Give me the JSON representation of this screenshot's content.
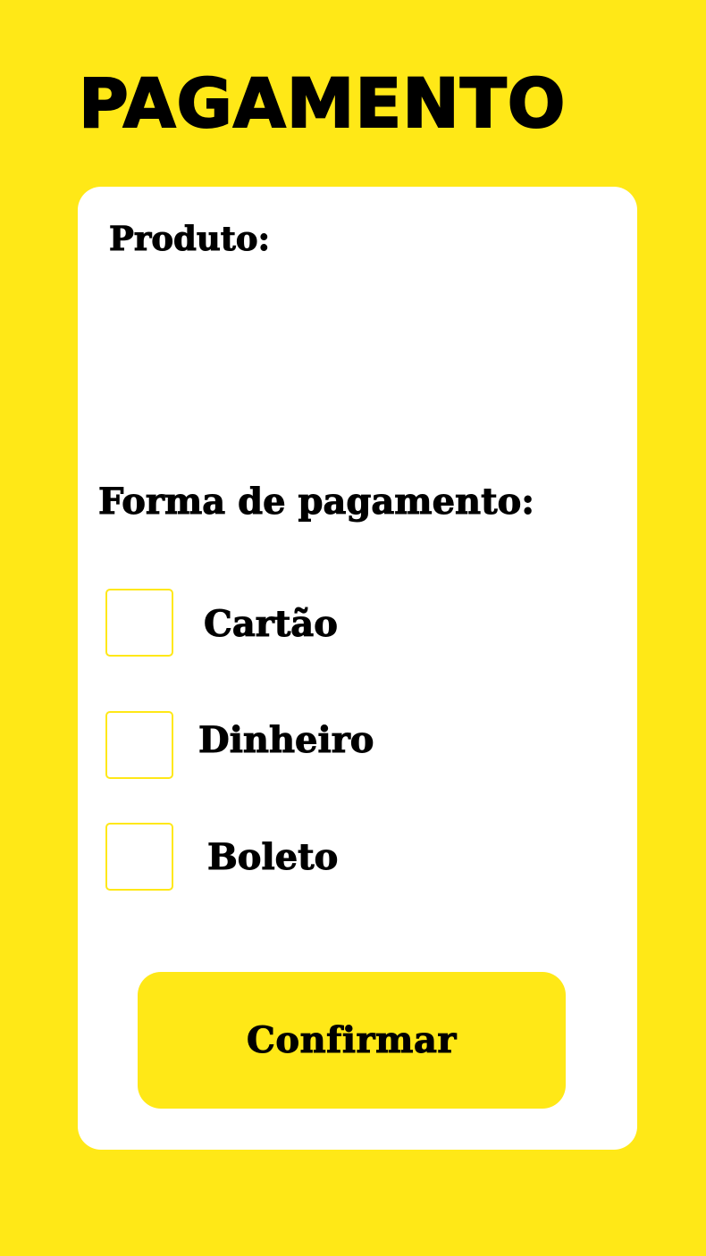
{
  "page": {
    "title": "PAGAMENTO"
  },
  "card": {
    "product_label": "Produto:",
    "payment_method_label": "Forma de pagamento:",
    "options": [
      {
        "label": "Cartão",
        "checked": false
      },
      {
        "label": "Dinheiro",
        "checked": false
      },
      {
        "label": "Boleto",
        "checked": false
      }
    ],
    "confirm_label": "Confirmar"
  },
  "colors": {
    "background": "#FFE817",
    "card": "#FFFFFF",
    "text": "#000000",
    "button": "#FFE817",
    "checkbox_border": "#FFE817"
  }
}
